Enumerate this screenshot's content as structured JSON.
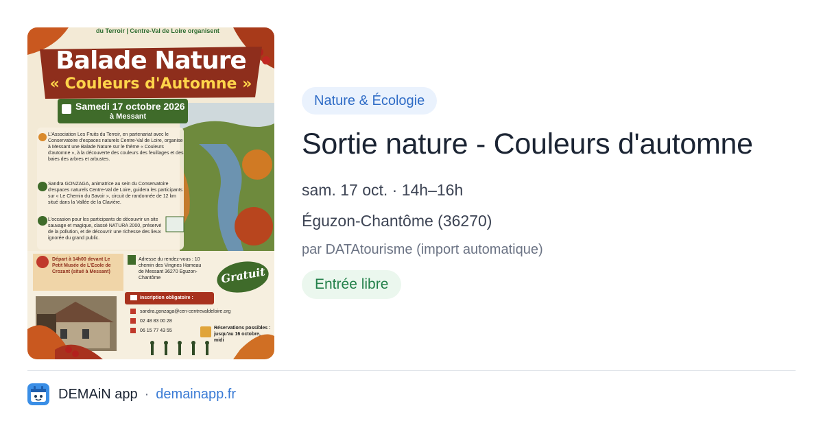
{
  "event": {
    "category": "Nature & Écologie",
    "title": "Sortie nature - Couleurs d'automne",
    "datetime": "sam. 17 oct. · 14h–16h",
    "location": "Éguzon-Chantôme (36270)",
    "author": "par DATAtourisme (import automatique)",
    "price_tag": "Entrée libre"
  },
  "poster": {
    "org_line": "du Terroir  |  Centre-Val de Loire  organisent",
    "title_line1": "Balade Nature",
    "title_line2": "« Couleurs d'Automne »",
    "date": "Samedi 17 octobre 2026",
    "place": "à Messant",
    "para1": "L'Association Les Fruits du Terroir, en partenariat avec le Conservatoire d'espaces naturels Centre-Val de Loire, organise à Messant une Balade Nature sur le thème « Couleurs d'automne », à la découverte des couleurs des feuillages et des baies des arbres et arbustes.",
    "para2": "Sandra GONZAGA, animatrice au sein du Conservatoire d'espaces naturels Centre-Val de Loire, guidera les participants sur « Le Chemin du Savoir », circuit de randonnée de 12 km situé dans la Vallée de la Clavière.",
    "para3": "L'occasion pour les participants de découvrir un site sauvage et magique, classé NATURA 2000, préservé de la pollution, et de découvrir une richesse des lieux ignorée du grand public.",
    "depart": "Départ à 14h00 devant Le Petit Musée de L'Ecole de Crozant (situé à Messant)",
    "rdv": "Adresse du rendez-vous : 10 chemin des Vingnes Hameau de Messant 36270 Eguzon-Chantôme",
    "gratuit": "Gratuit",
    "inscription": "Inscription obligatoire :",
    "email": "sandra.gonzaga@cen-centrevaldeloire.org",
    "phone1": "02 48 83 00 28",
    "phone2": "06 15 77 43 55",
    "reservation": "Réservations possibles : jusqu'au 16 octobre, midi"
  },
  "footer": {
    "app_name": "DEMAiN app",
    "separator": "·",
    "domain": "demainapp.fr",
    "icon": "app-logo-icon"
  },
  "colors": {
    "badge_bg": "#eaf2fd",
    "badge_text": "#2f6cc6",
    "free_bg": "#ebf7ee",
    "free_text": "#23804a",
    "link": "#3a7bd5"
  }
}
